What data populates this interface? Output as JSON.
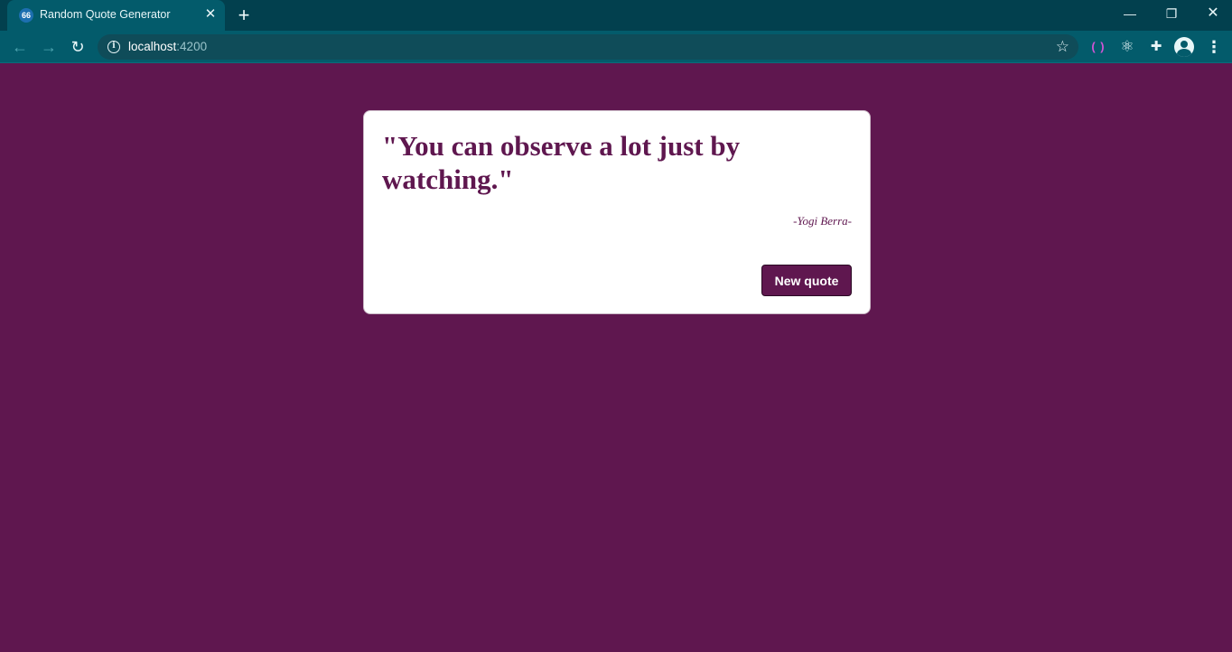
{
  "browser": {
    "tab": {
      "title": "Random Quote Generator",
      "favicon_glyph": "66",
      "close_glyph": "✕"
    },
    "new_tab_glyph": "+",
    "window_controls": {
      "minimize": "—",
      "maximize": "❐",
      "close": "✕"
    },
    "toolbar": {
      "back_glyph": "←",
      "forward_glyph": "→",
      "reload_glyph": "↻",
      "address": {
        "host": "localhost",
        "port": ":4200"
      },
      "info_glyph": "i",
      "star_glyph": "☆",
      "extension_1_glyph": "( )",
      "extension_2_glyph": "⚛",
      "extension_3_glyph": "✚",
      "menu_glyph": "⋮"
    }
  },
  "quote_card": {
    "quote": "\"You can observe a lot just by watching.\"",
    "author": "-Yogi Berra-",
    "button_label": "New quote"
  },
  "colors": {
    "page_background": "#5f174f",
    "card_background": "#ffffff",
    "accent": "#5f174f",
    "chrome_frame": "#02404e",
    "chrome_toolbar": "#035b6b"
  },
  "icons": {
    "favicon": "quote-favicon-icon",
    "back": "arrow-left-icon",
    "forward": "arrow-right-icon",
    "reload": "reload-icon",
    "info": "info-icon",
    "star": "star-icon",
    "extension_1": "brackets-extension-icon",
    "extension_2": "react-devtools-icon",
    "extension_3": "puzzle-piece-icon",
    "profile": "profile-avatar-icon",
    "menu": "kebab-menu-icon"
  }
}
